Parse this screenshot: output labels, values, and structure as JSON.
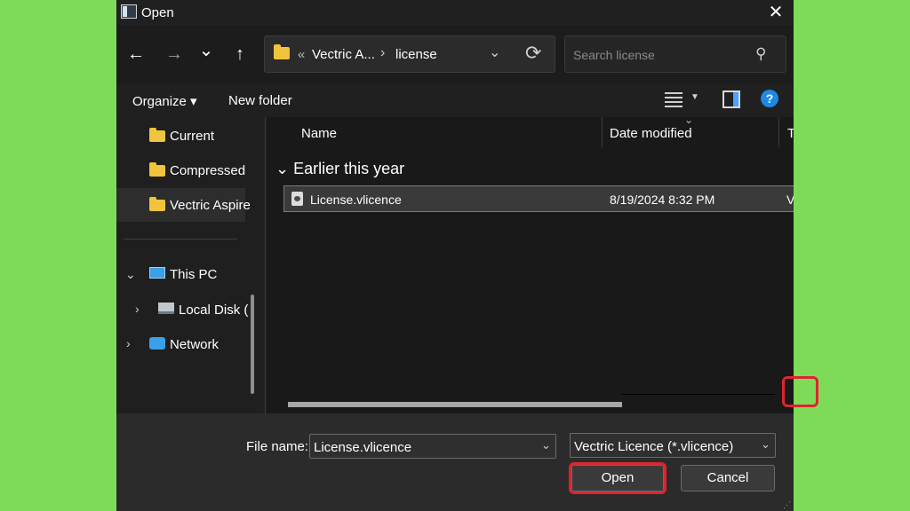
{
  "window": {
    "title": "Open"
  },
  "nav": {
    "back": "←",
    "forward": "→",
    "recent": "⌄",
    "up": "↑"
  },
  "address": {
    "overflow": "«",
    "segment1": "Vectric A...",
    "sep": "›",
    "segment2": "license",
    "dropdown": "⌄",
    "refresh": "⟳"
  },
  "search": {
    "placeholder": "Search license"
  },
  "toolbar": {
    "organize": "Organize ▾",
    "new_folder": "New folder",
    "help": "?"
  },
  "sidebar": {
    "items": [
      {
        "label": "Current"
      },
      {
        "label": "Compressed"
      },
      {
        "label": "Vectric Aspire"
      },
      {
        "label": "This PC"
      },
      {
        "label": "Local Disk ("
      },
      {
        "label": "Network"
      }
    ]
  },
  "columns": {
    "name": "Name",
    "date_modified": "Date modified",
    "type": "Ty"
  },
  "group": {
    "label": "⌄  Earlier this year"
  },
  "files": [
    {
      "name": "License.vlicence",
      "date": "8/19/2024 8:32 PM",
      "type": "V"
    }
  ],
  "bottom": {
    "filename_label": "File name:",
    "filename_value": "License.vlicence",
    "filetype_value": "Vectric Licence (*.vlicence)",
    "open_label": "Open",
    "cancel_label": "Cancel"
  },
  "colors": {
    "background": "#7ddb58",
    "highlight": "#e0232f",
    "dialog": "#202020"
  },
  "icons": [
    "app-icon",
    "close-icon",
    "back-arrow-icon",
    "forward-arrow-icon",
    "up-arrow-icon",
    "folder-icon",
    "refresh-icon",
    "search-icon",
    "view-icon",
    "preview-pane-icon",
    "help-icon",
    "pc-icon",
    "disk-icon",
    "network-icon",
    "file-icon",
    "resize-grip-icon"
  ]
}
